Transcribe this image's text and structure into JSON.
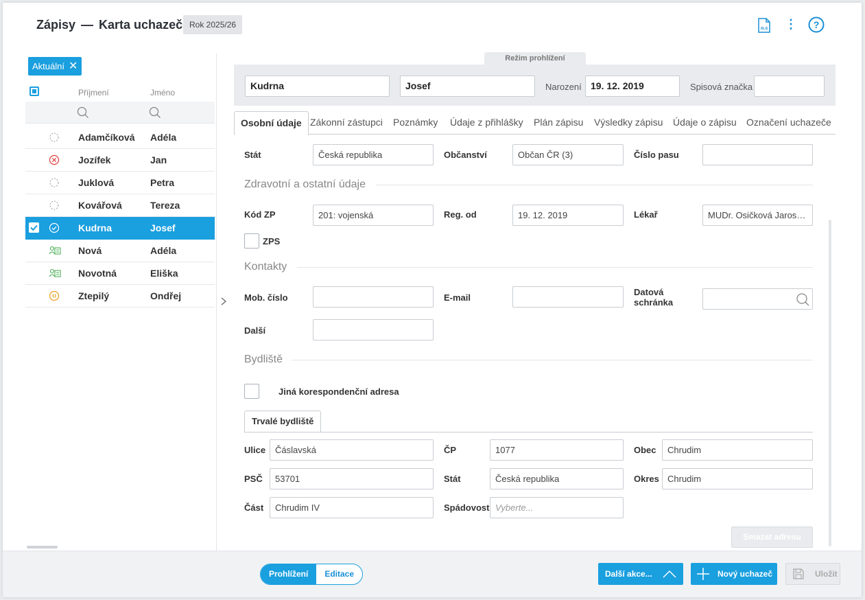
{
  "header": {
    "module": "Zápisy",
    "separator": "—",
    "page": "Karta uchazeče",
    "year": "Rok 2025/26",
    "xls_label": "XLS",
    "more_icon": "kebab-menu-icon",
    "help_icon": "help-icon"
  },
  "list": {
    "filter_chip": "Aktuální",
    "col_surname": "Příjmení",
    "col_firstname": "Jméno",
    "rows": [
      {
        "surname": "Adamčíková",
        "firstname": "Adéla",
        "status": "dashed-circle-icon"
      },
      {
        "surname": "Jozífek",
        "firstname": "Jan",
        "status": "x-circle-icon"
      },
      {
        "surname": "Juklová",
        "firstname": "Petra",
        "status": "dashed-circle-icon"
      },
      {
        "surname": "Kovářová",
        "firstname": "Tereza",
        "status": "dashed-circle-icon"
      },
      {
        "surname": "Kudrna",
        "firstname": "Josef",
        "status": "check-circle-icon",
        "selected": true
      },
      {
        "surname": "Nová",
        "firstname": "Adéla",
        "status": "person-card-icon"
      },
      {
        "surname": "Novotná",
        "firstname": "Eliška",
        "status": "person-card-icon"
      },
      {
        "surname": "Ztepilý",
        "firstname": "Ondřej",
        "status": "pause-circle-icon"
      }
    ]
  },
  "mode_label": "Režim prohlížení",
  "ident": {
    "surname": "Kudrna",
    "firstname": "Josef",
    "birth_label": "Narození",
    "birth": "19. 12. 2019",
    "file_label": "Spisová značka",
    "file": ""
  },
  "tabs": [
    "Osobní údaje",
    "Zákonní zástupci",
    "Poznámky",
    "Údaje z přihlášky",
    "Plán zápisu",
    "Výsledky zápisu",
    "Údaje o zápisu",
    "Označení uchazeče"
  ],
  "personal": {
    "state_label": "Stát",
    "state": "Česká republika",
    "citizenship_label": "Občanství",
    "citizenship": "Občan ČR (3)",
    "passport_label": "Číslo pasu",
    "passport": ""
  },
  "health": {
    "title": "Zdravotní a ostatní údaje",
    "zp_label": "Kód ZP",
    "zp": "201: vojenská",
    "reg_label": "Reg. od",
    "reg": "19. 12. 2019",
    "doctor_label": "Lékař",
    "doctor": "MUDr. Osičková Jaroslava",
    "zps_label": "ZPS"
  },
  "contacts": {
    "title": "Kontakty",
    "mobile_label": "Mob. číslo",
    "mobile": "",
    "email_label": "E-mail",
    "email": "",
    "databox_label_1": "Datová",
    "databox_label_2": "schránka",
    "other_label": "Další",
    "other": ""
  },
  "residence": {
    "title": "Bydliště",
    "alt_address_label": "Jiná korespondenční adresa",
    "subtab": "Trvalé bydliště",
    "street_label": "Ulice",
    "street": "Čáslavská",
    "cp_label": "ČP",
    "cp": "1077",
    "city_label": "Obec",
    "city": "Chrudim",
    "zip_label": "PSČ",
    "zip": "53701",
    "state_label": "Stát",
    "state": "Česká republika",
    "district_label": "Okres",
    "district": "Chrudim",
    "part_label": "Část",
    "part": "Chrudim IV",
    "catchment_label": "Spádovost",
    "catchment_placeholder": "Vyberte...",
    "delete_button": "Smazat adresu"
  },
  "footer": {
    "view": "Prohlížení",
    "edit": "Editace",
    "more_actions": "Další akce...",
    "new_applicant": "Nový uchazeč",
    "save": "Uložit"
  },
  "colors": {
    "accent": "#1a9fdf",
    "error": "#e03c3c",
    "pause": "#f0a020",
    "person": "#3ea84a"
  }
}
